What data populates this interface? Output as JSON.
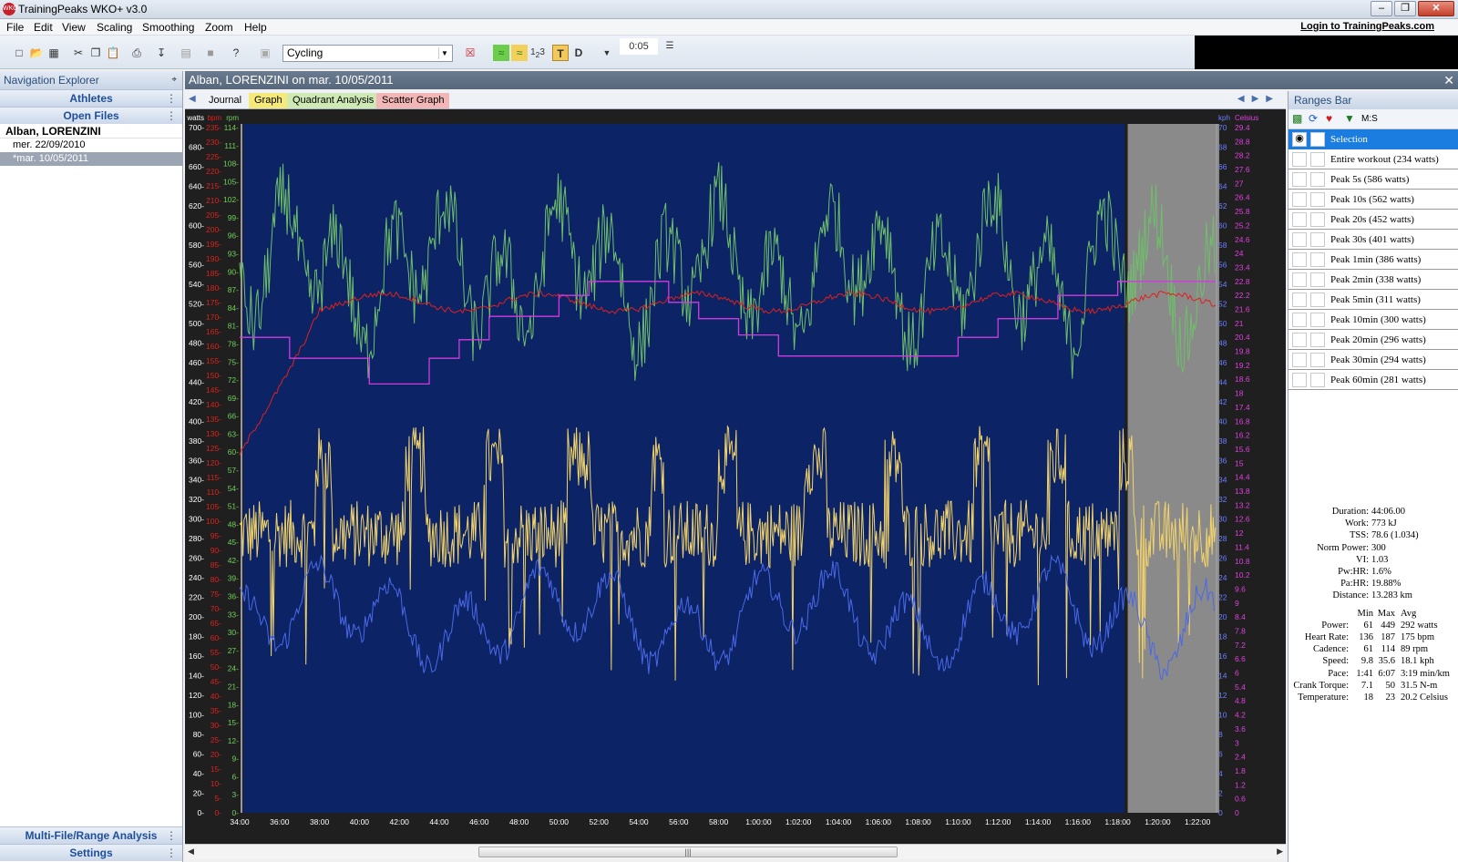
{
  "window": {
    "title": "TrainingPeaks WKO+ v3.0",
    "icon_label": "WKO"
  },
  "menu": {
    "items": [
      "File",
      "Edit",
      "View",
      "Scaling",
      "Smoothing",
      "Zoom",
      "Help"
    ],
    "login": "Login to TrainingPeaks.com"
  },
  "toolbar": {
    "sport": "Cycling",
    "smoothing_value": "0:05",
    "t_label": "T",
    "d_label": "D"
  },
  "nav": {
    "title": "Navigation Explorer",
    "athletes": "Athletes",
    "open_files": "Open Files",
    "athlete_name": "Alban, LORENZINI",
    "files": [
      "mer. 22/09/2010",
      "*mar. 10/05/2011"
    ],
    "multi_file": "Multi-File/Range Analysis",
    "settings": "Settings"
  },
  "document": {
    "title": "Alban, LORENZINI on mar. 10/05/2011",
    "tabs": [
      "Journal",
      "Graph",
      "Quadrant Analysis",
      "Scatter Graph"
    ]
  },
  "chart_data": {
    "type": "line",
    "x_ticks": [
      "34:00",
      "36:00",
      "38:00",
      "40:00",
      "42:00",
      "44:00",
      "46:00",
      "48:00",
      "50:00",
      "52:00",
      "54:00",
      "56:00",
      "58:00",
      "1:00:00",
      "1:02:00",
      "1:04:00",
      "1:06:00",
      "1:08:00",
      "1:10:00",
      "1:12:00",
      "1:14:00",
      "1:16:00",
      "1:18:00",
      "1:20:00",
      "1:22:00"
    ],
    "axes": {
      "watts": {
        "label": "watts",
        "ticks": [
          "0-",
          "20-",
          "40-",
          "60-",
          "80-",
          "100-",
          "120-",
          "140-",
          "160-",
          "180-",
          "200-",
          "220-",
          "240-",
          "260-",
          "280-",
          "300-",
          "320-",
          "340-",
          "360-",
          "380-",
          "400-",
          "420-",
          "440-",
          "460-",
          "480-",
          "500-",
          "520-",
          "540-",
          "560-",
          "580-",
          "600-",
          "620-",
          "640-",
          "660-",
          "680-",
          "700-"
        ],
        "color": "#ffffff"
      },
      "bpm": {
        "label": "bpm",
        "ticks": [
          "0-",
          "5-",
          "10-",
          "15-",
          "20-",
          "25-",
          "30-",
          "35-",
          "40-",
          "45-",
          "50-",
          "55-",
          "60-",
          "65-",
          "70-",
          "75-",
          "80-",
          "85-",
          "90-",
          "95-",
          "100-",
          "105-",
          "110-",
          "115-",
          "120-",
          "125-",
          "130-",
          "135-",
          "140-",
          "145-",
          "150-",
          "155-",
          "160-",
          "165-",
          "170-",
          "175-",
          "180-",
          "185-",
          "190-",
          "195-",
          "200-",
          "205-",
          "210-",
          "215-",
          "220-",
          "225-",
          "230-",
          "235-"
        ],
        "color": "#e0201a"
      },
      "rpm": {
        "label": "rpm",
        "ticks": [
          "0-",
          "3-",
          "6-",
          "9-",
          "12-",
          "15-",
          "18-",
          "21-",
          "24-",
          "27-",
          "30-",
          "33-",
          "36-",
          "39-",
          "42-",
          "45-",
          "48-",
          "51-",
          "54-",
          "57-",
          "60-",
          "63-",
          "66-",
          "69-",
          "72-",
          "75-",
          "78-",
          "81-",
          "84-",
          "87-",
          "90-",
          "93-",
          "96-",
          "99-",
          "102-",
          "105-",
          "108-",
          "111-",
          "114-"
        ],
        "color": "#6fcf5a"
      },
      "kph": {
        "label": "kph",
        "ticks": [
          "0",
          "2",
          "4",
          "6",
          "8",
          "10",
          "12",
          "14",
          "16",
          "18",
          "20",
          "22",
          "24",
          "26",
          "28",
          "30",
          "32",
          "34",
          "36",
          "38",
          "40",
          "42",
          "44",
          "46",
          "48",
          "50",
          "52",
          "54",
          "56",
          "58",
          "60",
          "62",
          "64",
          "66",
          "68",
          "70"
        ],
        "color": "#6a7fff"
      },
      "celsius": {
        "label": "Celsius",
        "ticks": [
          "0",
          "0.6",
          "1.2",
          "1.8",
          "2.4",
          "3",
          "3.6",
          "4.2",
          "4.8",
          "5.4",
          "6",
          "6.6",
          "7.2",
          "7.8",
          "8.4",
          "9",
          "9.6",
          "10.2",
          "10.8",
          "11.4",
          "12",
          "12.6",
          "13.2",
          "13.8",
          "14.4",
          "15",
          "15.6",
          "16.2",
          "16.8",
          "17.4",
          "18",
          "18.6",
          "19.2",
          "19.8",
          "20.4",
          "21",
          "21.6",
          "22.2",
          "22.8",
          "23.4",
          "24",
          "24.6",
          "25.2",
          "25.8",
          "26.4",
          "27",
          "27.6",
          "28.2",
          "28.8",
          "29.4"
        ],
        "color": "#e040e0"
      }
    },
    "series": [
      {
        "name": "Power",
        "color": "#f2d36b"
      },
      {
        "name": "Heart Rate",
        "color": "#e0201a"
      },
      {
        "name": "Cadence",
        "color": "#6fbf6a"
      },
      {
        "name": "Speed",
        "color": "#4a68e8"
      },
      {
        "name": "Temperature",
        "color": "#d23ae0"
      }
    ],
    "temperature_steps": [
      {
        "t": "34:00",
        "celsius": 20.4
      },
      {
        "t": "36:30",
        "celsius": 19.5
      },
      {
        "t": "40:30",
        "celsius": 18.4
      },
      {
        "t": "43:30",
        "celsius": 19.5
      },
      {
        "t": "45:00",
        "celsius": 20.3
      },
      {
        "t": "46:30",
        "celsius": 21.3
      },
      {
        "t": "50:00",
        "celsius": 22.2
      },
      {
        "t": "51:30",
        "celsius": 22.8
      },
      {
        "t": "55:30",
        "celsius": 21.9
      },
      {
        "t": "57:00",
        "celsius": 21.2
      },
      {
        "t": "59:00",
        "celsius": 20.5
      },
      {
        "t": "1:01:00",
        "celsius": 19.6
      },
      {
        "t": "1:10:00",
        "celsius": 20.4
      },
      {
        "t": "1:12:00",
        "celsius": 21.2
      },
      {
        "t": "1:15:00",
        "celsius": 22.2
      },
      {
        "t": "1:18:00",
        "celsius": 22.8
      }
    ],
    "selection_range": [
      "1:18:30",
      "1:23:00"
    ]
  },
  "ranges": {
    "title": "Ranges Bar",
    "ms_label": "M:S",
    "items": [
      "Selection",
      "Entire workout (234 watts)",
      "Peak 5s (586 watts)",
      "Peak 10s (562 watts)",
      "Peak 20s (452 watts)",
      "Peak 30s (401 watts)",
      "Peak 1min (386 watts)",
      "Peak 2min (338 watts)",
      "Peak 5min (311 watts)",
      "Peak 10min (300 watts)",
      "Peak 20min (296 watts)",
      "Peak 30min (294 watts)",
      "Peak 60min (281 watts)"
    ]
  },
  "summary": {
    "rows": [
      {
        "k": "Duration:",
        "v": "44:06.00"
      },
      {
        "k": "Work:",
        "v": "773 kJ"
      },
      {
        "k": "TSS:",
        "v": "78.6 (1.034)"
      },
      {
        "k": "Norm Power:",
        "v": "300"
      },
      {
        "k": "VI:",
        "v": "1.03"
      },
      {
        "k": "Pw:HR:",
        "v": "1.6%"
      },
      {
        "k": "Pa:HR:",
        "v": "19.88%"
      },
      {
        "k": "Distance:",
        "v": "13.283 km"
      }
    ],
    "header": {
      "min": "Min",
      "max": "Max",
      "avg": "Avg"
    },
    "stats": [
      {
        "label": "Power:",
        "min": "61",
        "max": "449",
        "avg": "292 watts"
      },
      {
        "label": "Heart Rate:",
        "min": "136",
        "max": "187",
        "avg": "175 bpm"
      },
      {
        "label": "Cadence:",
        "min": "61",
        "max": "114",
        "avg": "89 rpm"
      },
      {
        "label": "Speed:",
        "min": "9.8",
        "max": "35.6",
        "avg": "18.1 kph"
      },
      {
        "label": "Pace:",
        "min": "1:41",
        "max": "6:07",
        "avg": "3:19 min/km"
      },
      {
        "label": "Crank Torque:",
        "min": "7.1",
        "max": "50",
        "avg": "31.5 N-m"
      },
      {
        "label": "Temperature:",
        "min": "18",
        "max": "23",
        "avg": "20.2 Celsius"
      }
    ]
  }
}
